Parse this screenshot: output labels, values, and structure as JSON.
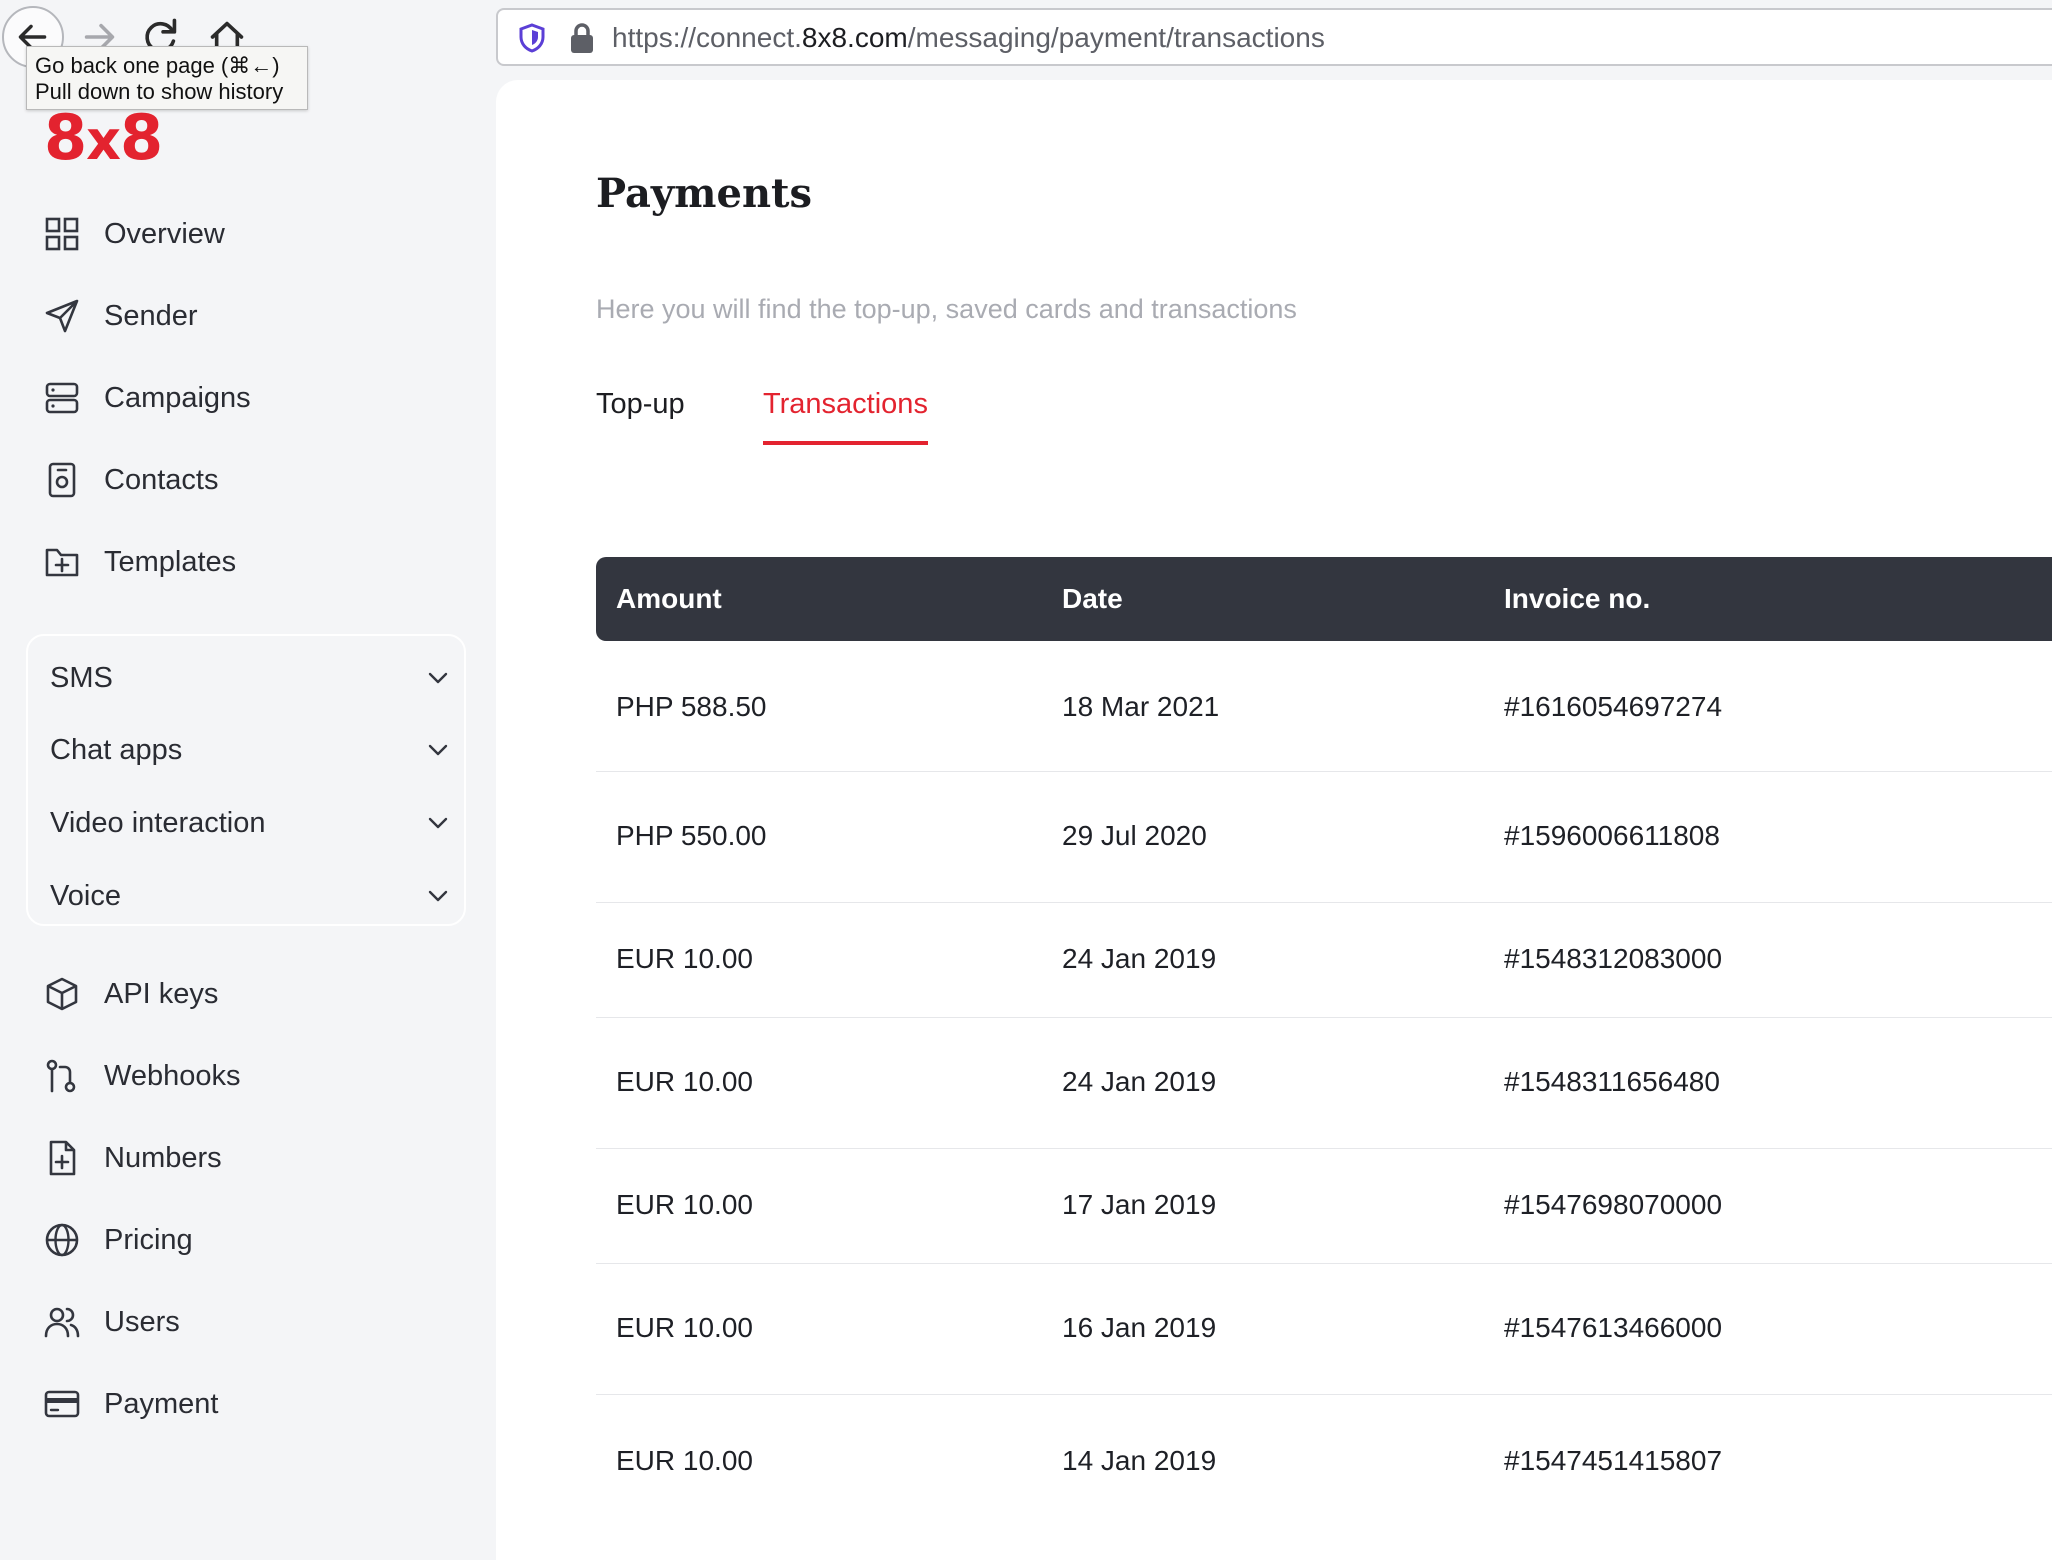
{
  "browser": {
    "url_prefix": "https://connect.",
    "url_domain": "8x8.com",
    "url_path": "/messaging/payment/transactions",
    "tooltip_line1": "Go back one page (⌘←)",
    "tooltip_line2": "Pull down to show history"
  },
  "logo": {
    "part1": "8",
    "part2": "x",
    "part3": "8"
  },
  "sidebar": {
    "items_top": [
      {
        "label": "Overview",
        "icon": "grid-icon"
      },
      {
        "label": "Sender",
        "icon": "send-icon"
      },
      {
        "label": "Campaigns",
        "icon": "campaigns-icon"
      },
      {
        "label": "Contacts",
        "icon": "contact-card-icon"
      },
      {
        "label": "Templates",
        "icon": "folder-plus-icon"
      }
    ],
    "channels": [
      {
        "label": "SMS"
      },
      {
        "label": "Chat apps"
      },
      {
        "label": "Video interaction"
      },
      {
        "label": "Voice"
      }
    ],
    "items_bottom": [
      {
        "label": "API keys",
        "icon": "cube-icon"
      },
      {
        "label": "Webhooks",
        "icon": "git-branch-icon"
      },
      {
        "label": "Numbers",
        "icon": "file-plus-icon"
      },
      {
        "label": "Pricing",
        "icon": "globe-icon"
      },
      {
        "label": "Users",
        "icon": "users-icon"
      },
      {
        "label": "Payment",
        "icon": "credit-card-icon"
      }
    ]
  },
  "main": {
    "title": "Payments",
    "subtitle": "Here you will find the top-up, saved cards and transactions",
    "tabs": [
      {
        "label": "Top-up",
        "active": false
      },
      {
        "label": "Transactions",
        "active": true
      }
    ]
  },
  "table": {
    "headers": [
      "Amount",
      "Date",
      "Invoice no."
    ],
    "rows": [
      [
        "PHP 588.50",
        "18 Mar 2021",
        "#1616054697274"
      ],
      [
        "PHP 550.00",
        "29 Jul 2020",
        "#1596006611808"
      ],
      [
        "EUR 10.00",
        "24 Jan 2019",
        "#1548312083000"
      ],
      [
        "EUR 10.00",
        "24 Jan 2019",
        "#1548311656480"
      ],
      [
        "EUR 10.00",
        "17 Jan 2019",
        "#1547698070000"
      ],
      [
        "EUR 10.00",
        "16 Jan 2019",
        "#1547613466000"
      ],
      [
        "EUR 10.00",
        "14 Jan 2019",
        "#1547451415807"
      ]
    ]
  },
  "colors": {
    "brand_red": "#e3232f",
    "header_dark": "#33363f",
    "sidebar_bg": "#f4f5f7"
  }
}
